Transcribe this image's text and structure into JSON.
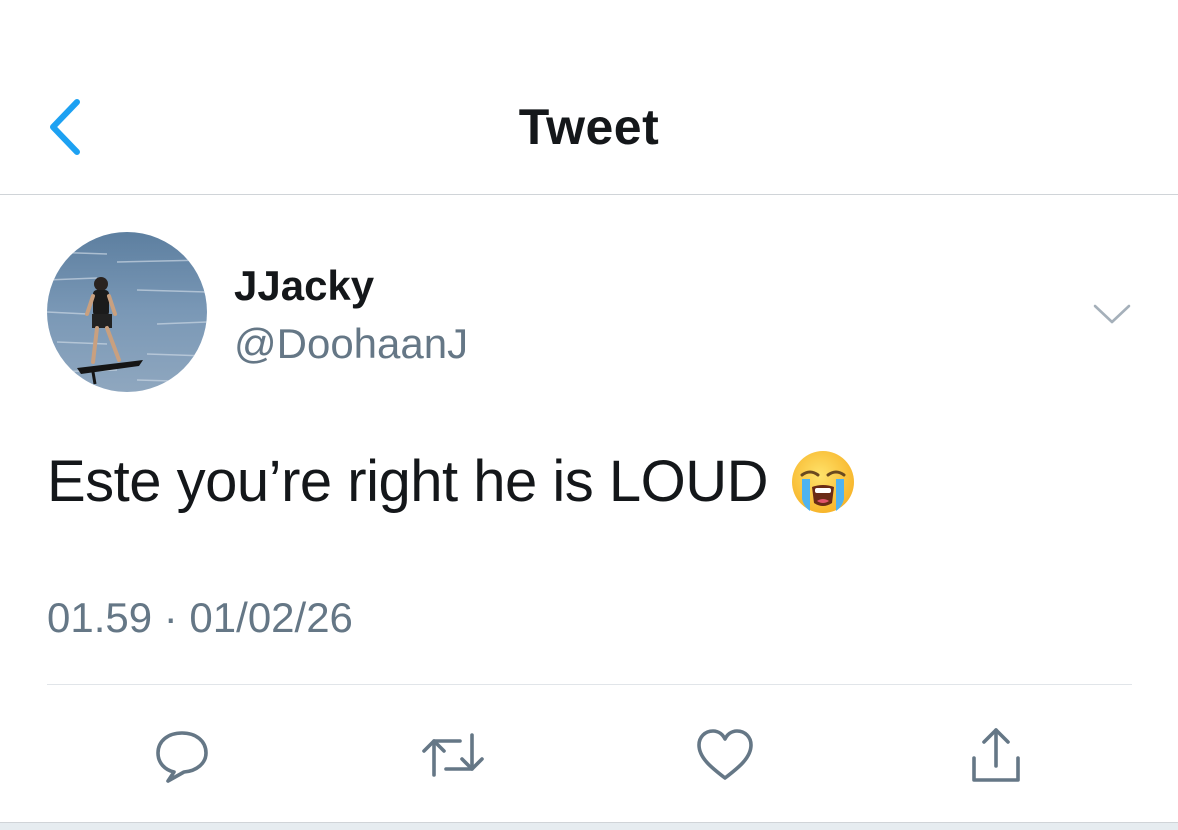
{
  "header": {
    "title": "Tweet",
    "back_icon": "chevron-left-icon",
    "accent_color": "#1da1f2"
  },
  "tweet": {
    "display_name": "JJacky",
    "handle": "@DoohaanJ",
    "text": "Este you’re right he is LOUD",
    "emoji": "loudly-crying-face",
    "timestamp": "01.59 · 01/02/26"
  },
  "actions": {
    "reply_icon": "reply-icon",
    "retweet_icon": "retweet-icon",
    "like_icon": "heart-icon",
    "share_icon": "share-icon"
  },
  "colors": {
    "text_primary": "#14171a",
    "text_secondary": "#657786",
    "icon_gray": "#657786"
  }
}
